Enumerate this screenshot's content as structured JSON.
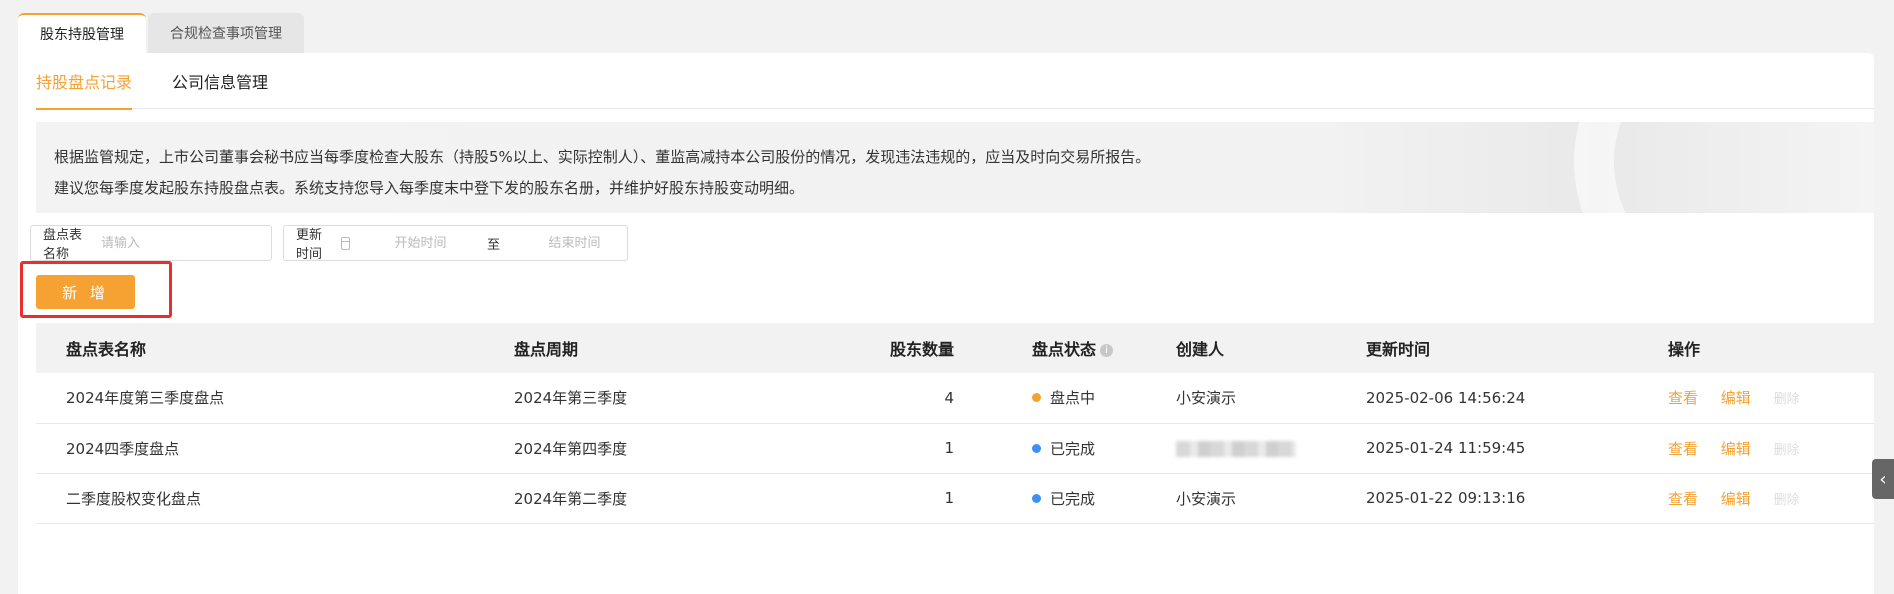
{
  "top_tabs": [
    {
      "label": "股东持股管理",
      "active": true
    },
    {
      "label": "合规检查事项管理",
      "active": false
    }
  ],
  "sub_tabs": [
    {
      "label": "持股盘点记录",
      "active": true
    },
    {
      "label": "公司信息管理",
      "active": false
    }
  ],
  "notice": {
    "line1": "根据监管规定，上市公司董事会秘书应当每季度检查大股东（持股5%以上、实际控制人）、董监高减持本公司股份的情况，发现违法违规的，应当及时向交易所报告。",
    "line2": "建议您每季度发起股东持股盘点表。系统支持您导入每季度末中登下发的股东名册，并维护好股东持股变动明细。"
  },
  "filters": {
    "name_label": "盘点表名称",
    "name_placeholder": "请输入",
    "time_label": "更新时间",
    "start_placeholder": "开始时间",
    "to_label": "至",
    "end_placeholder": "结束时间"
  },
  "add_button": "新 增",
  "table": {
    "headers": {
      "name": "盘点表名称",
      "period": "盘点周期",
      "count": "股东数量",
      "status": "盘点状态",
      "creator": "创建人",
      "time": "更新时间",
      "ops": "操作"
    },
    "rows": [
      {
        "name": "2024年度第三季度盘点",
        "period": "2024年第三季度",
        "count": "4",
        "status": "盘点中",
        "status_color": "#f5a233",
        "creator": "小安演示",
        "creator_blurred": false,
        "time": "2025-02-06 14:56:24"
      },
      {
        "name": "2024四季度盘点",
        "period": "2024年第四季度",
        "count": "1",
        "status": "已完成",
        "status_color": "#3d8ef7",
        "creator": "",
        "creator_blurred": true,
        "time": "2025-01-24 11:59:45"
      },
      {
        "name": "二季度股权变化盘点",
        "period": "2024年第二季度",
        "count": "1",
        "status": "已完成",
        "status_color": "#3d8ef7",
        "creator": "小安演示",
        "creator_blurred": false,
        "time": "2025-01-22 09:13:16"
      }
    ],
    "ops": {
      "view": "查看",
      "edit": "编辑",
      "delete": "删除"
    }
  },
  "side_handle_icon": "chevron-left-icon"
}
